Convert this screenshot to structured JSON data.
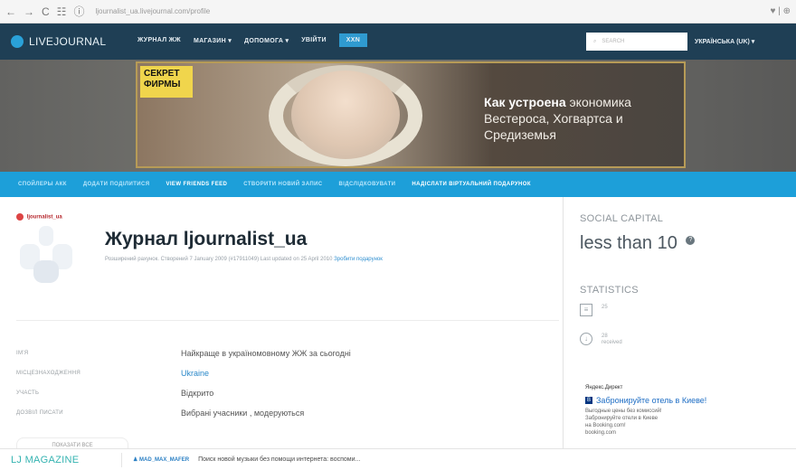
{
  "browser": {
    "back": "←",
    "forward": "→",
    "reload": "C",
    "apps": "☷",
    "info": "ⓘ",
    "url": "ljournalist_ua.livejournal.com/profile",
    "right": "♥ | ⊕"
  },
  "header": {
    "logo": "LIVEJOURNAL",
    "menu": [
      "ЖУРНАЛ ЖЖ",
      "МАГАЗИН ▾",
      "ДОПОМОГА ▾",
      "УВІЙТИ",
      "XXN"
    ],
    "search_placeholder": "SEARCH",
    "language": "УКРАЇНСЬКА (UK) ▾"
  },
  "banner": {
    "badge": "СЕКРЕТ ФИРМЫ",
    "line1_bold": "Как устроена",
    "line1_thin": "экономика",
    "line2": "Вестероса, Хогвартса и",
    "line3": "Средиземья"
  },
  "subnav": [
    "СПОЙЛЕРЫ АКК",
    "ДОДАТИ ПОДІЛИТИСЯ",
    "VIEW FRIENDS FEED",
    "СТВОРИТИ НОВИЙ ЗАПИС",
    "ВІДСЛІДКОВУВАТИ",
    "НАДІСЛАТИ ВІРТУАЛЬНИЙ ПОДАРУНОК"
  ],
  "profile": {
    "username": "ljournalist_ua",
    "title": "Журнал ljournalist_ua",
    "meta_text": "Розширений рахунок. Створений 7 January 2009 (#17911049) Last updated on 25 April 2010",
    "meta_link": "Зробити подарунок",
    "rows": [
      {
        "label": "ІМ'Я",
        "value": "Найкраще в україномовному ЖЖ за сьогодні"
      },
      {
        "label": "МІСЦЕЗНАХОДЖЕННЯ",
        "value": "Ukraine"
      },
      {
        "label": "УЧАСТЬ",
        "value": "Відкрито"
      },
      {
        "label": "ДОЗВІЛ ПИСАТИ",
        "value": "Вибрані учасники , модеруються"
      }
    ],
    "more_button": "ПОКАЗАТИ ВСЕ"
  },
  "sidebar": {
    "social_capital_label": "SOCIAL CAPITAL",
    "social_capital_value": "less than 10",
    "info_icon": "?",
    "statistics_label": "STATISTICS",
    "stats": [
      {
        "icon": "≡",
        "value": "25",
        "caption": ""
      },
      {
        "icon": "↓",
        "value": "28",
        "caption": "received"
      }
    ],
    "ad": {
      "source": "Яндекс.Директ",
      "icon": "B",
      "title": "Забронируйте отель в Киеве!",
      "desc1": "Выгодные цены без комиссий!",
      "desc2": "Забронируйте отели в Киеве",
      "desc3": "на Booking.com!",
      "desc4": "booking.com"
    }
  },
  "footer": {
    "magazine": "LJ MAGAZINE",
    "user": "♟ MAD_MAX_MAFER",
    "text": "Поиск новой музыки без помощи интернета: воспоми..."
  }
}
